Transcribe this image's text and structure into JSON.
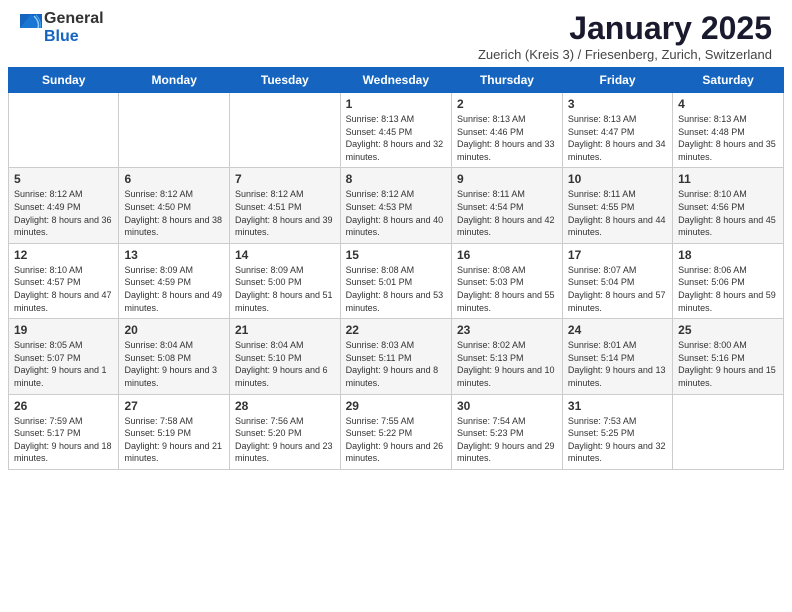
{
  "header": {
    "logo_general": "General",
    "logo_blue": "Blue",
    "title": "January 2025",
    "subtitle": "Zuerich (Kreis 3) / Friesenberg, Zurich, Switzerland"
  },
  "weekdays": [
    "Sunday",
    "Monday",
    "Tuesday",
    "Wednesday",
    "Thursday",
    "Friday",
    "Saturday"
  ],
  "weeks": [
    [
      {
        "day": "",
        "info": ""
      },
      {
        "day": "",
        "info": ""
      },
      {
        "day": "",
        "info": ""
      },
      {
        "day": "1",
        "info": "Sunrise: 8:13 AM\nSunset: 4:45 PM\nDaylight: 8 hours and 32 minutes."
      },
      {
        "day": "2",
        "info": "Sunrise: 8:13 AM\nSunset: 4:46 PM\nDaylight: 8 hours and 33 minutes."
      },
      {
        "day": "3",
        "info": "Sunrise: 8:13 AM\nSunset: 4:47 PM\nDaylight: 8 hours and 34 minutes."
      },
      {
        "day": "4",
        "info": "Sunrise: 8:13 AM\nSunset: 4:48 PM\nDaylight: 8 hours and 35 minutes."
      }
    ],
    [
      {
        "day": "5",
        "info": "Sunrise: 8:12 AM\nSunset: 4:49 PM\nDaylight: 8 hours and 36 minutes."
      },
      {
        "day": "6",
        "info": "Sunrise: 8:12 AM\nSunset: 4:50 PM\nDaylight: 8 hours and 38 minutes."
      },
      {
        "day": "7",
        "info": "Sunrise: 8:12 AM\nSunset: 4:51 PM\nDaylight: 8 hours and 39 minutes."
      },
      {
        "day": "8",
        "info": "Sunrise: 8:12 AM\nSunset: 4:53 PM\nDaylight: 8 hours and 40 minutes."
      },
      {
        "day": "9",
        "info": "Sunrise: 8:11 AM\nSunset: 4:54 PM\nDaylight: 8 hours and 42 minutes."
      },
      {
        "day": "10",
        "info": "Sunrise: 8:11 AM\nSunset: 4:55 PM\nDaylight: 8 hours and 44 minutes."
      },
      {
        "day": "11",
        "info": "Sunrise: 8:10 AM\nSunset: 4:56 PM\nDaylight: 8 hours and 45 minutes."
      }
    ],
    [
      {
        "day": "12",
        "info": "Sunrise: 8:10 AM\nSunset: 4:57 PM\nDaylight: 8 hours and 47 minutes."
      },
      {
        "day": "13",
        "info": "Sunrise: 8:09 AM\nSunset: 4:59 PM\nDaylight: 8 hours and 49 minutes."
      },
      {
        "day": "14",
        "info": "Sunrise: 8:09 AM\nSunset: 5:00 PM\nDaylight: 8 hours and 51 minutes."
      },
      {
        "day": "15",
        "info": "Sunrise: 8:08 AM\nSunset: 5:01 PM\nDaylight: 8 hours and 53 minutes."
      },
      {
        "day": "16",
        "info": "Sunrise: 8:08 AM\nSunset: 5:03 PM\nDaylight: 8 hours and 55 minutes."
      },
      {
        "day": "17",
        "info": "Sunrise: 8:07 AM\nSunset: 5:04 PM\nDaylight: 8 hours and 57 minutes."
      },
      {
        "day": "18",
        "info": "Sunrise: 8:06 AM\nSunset: 5:06 PM\nDaylight: 8 hours and 59 minutes."
      }
    ],
    [
      {
        "day": "19",
        "info": "Sunrise: 8:05 AM\nSunset: 5:07 PM\nDaylight: 9 hours and 1 minute."
      },
      {
        "day": "20",
        "info": "Sunrise: 8:04 AM\nSunset: 5:08 PM\nDaylight: 9 hours and 3 minutes."
      },
      {
        "day": "21",
        "info": "Sunrise: 8:04 AM\nSunset: 5:10 PM\nDaylight: 9 hours and 6 minutes."
      },
      {
        "day": "22",
        "info": "Sunrise: 8:03 AM\nSunset: 5:11 PM\nDaylight: 9 hours and 8 minutes."
      },
      {
        "day": "23",
        "info": "Sunrise: 8:02 AM\nSunset: 5:13 PM\nDaylight: 9 hours and 10 minutes."
      },
      {
        "day": "24",
        "info": "Sunrise: 8:01 AM\nSunset: 5:14 PM\nDaylight: 9 hours and 13 minutes."
      },
      {
        "day": "25",
        "info": "Sunrise: 8:00 AM\nSunset: 5:16 PM\nDaylight: 9 hours and 15 minutes."
      }
    ],
    [
      {
        "day": "26",
        "info": "Sunrise: 7:59 AM\nSunset: 5:17 PM\nDaylight: 9 hours and 18 minutes."
      },
      {
        "day": "27",
        "info": "Sunrise: 7:58 AM\nSunset: 5:19 PM\nDaylight: 9 hours and 21 minutes."
      },
      {
        "day": "28",
        "info": "Sunrise: 7:56 AM\nSunset: 5:20 PM\nDaylight: 9 hours and 23 minutes."
      },
      {
        "day": "29",
        "info": "Sunrise: 7:55 AM\nSunset: 5:22 PM\nDaylight: 9 hours and 26 minutes."
      },
      {
        "day": "30",
        "info": "Sunrise: 7:54 AM\nSunset: 5:23 PM\nDaylight: 9 hours and 29 minutes."
      },
      {
        "day": "31",
        "info": "Sunrise: 7:53 AM\nSunset: 5:25 PM\nDaylight: 9 hours and 32 minutes."
      },
      {
        "day": "",
        "info": ""
      }
    ]
  ]
}
